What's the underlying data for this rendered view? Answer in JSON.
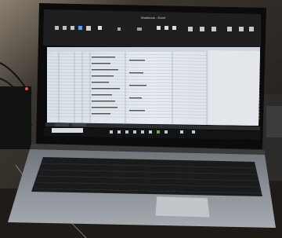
{
  "scene": {
    "subject": "laptop",
    "screen_app": "spreadsheet",
    "screen_title": "Workbook - Excel",
    "colors": {
      "background_dark": "#1c1a18",
      "screen_bezel": "#0b0b0b",
      "ribbon": "#1f1f1f",
      "sheet_bg": "#e9eef3",
      "grid_line": "#b9c2cb",
      "taskbar": "#111315",
      "keyboard_deck": "#8f949a",
      "keys": "#1a1b1d"
    }
  }
}
